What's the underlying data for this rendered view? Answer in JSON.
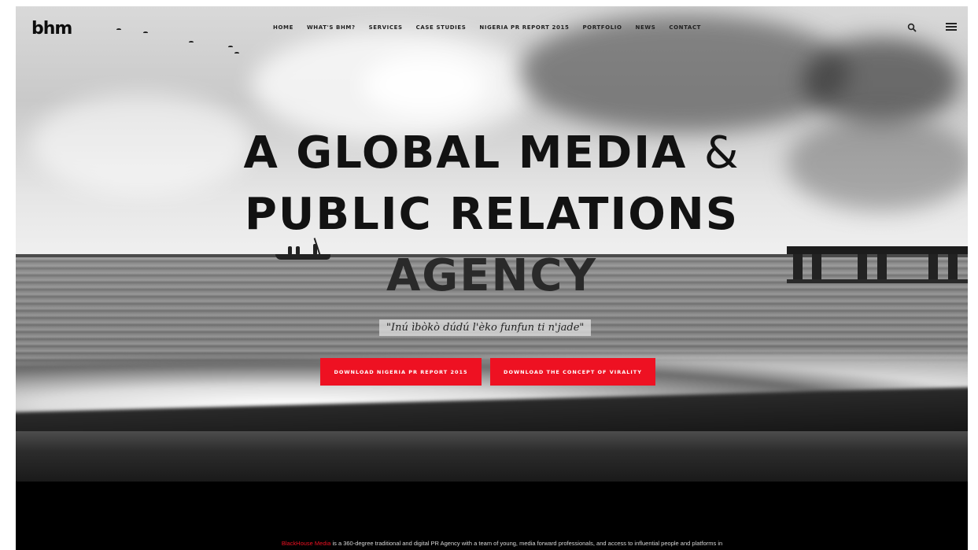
{
  "logo": "bhm",
  "nav": {
    "items": [
      "HOME",
      "WHAT'S BHM?",
      "SERVICES",
      "CASE STUDIES",
      "NIGERIA PR REPORT 2015",
      "PORTFOLIO",
      "NEWS",
      "CONTACT"
    ]
  },
  "icons": {
    "search": "search-icon",
    "menu": "hamburger-menu-icon"
  },
  "hero": {
    "headline_line1": "A GLOBAL MEDIA",
    "headline_amp": "&",
    "headline_line2": "PUBLIC RELATIONS",
    "headline_line3": "AGENCY",
    "tagline": "\"Inú ìbòkò dúdú l'èko funfun ti n'jade\"",
    "cta_primary": "DOWNLOAD NIGERIA PR REPORT 2015",
    "cta_secondary": "DOWNLOAD THE CONCEPT OF VIRALITY"
  },
  "about": {
    "brand": "BlackHouse Media",
    "text": " is a 360-degree traditional and digital PR Agency with a team of young, media forward professionals, and access to influential people and platforms in"
  },
  "colors": {
    "accent": "#ee1122",
    "text_dark": "#121212",
    "footer_bg": "#000000"
  }
}
